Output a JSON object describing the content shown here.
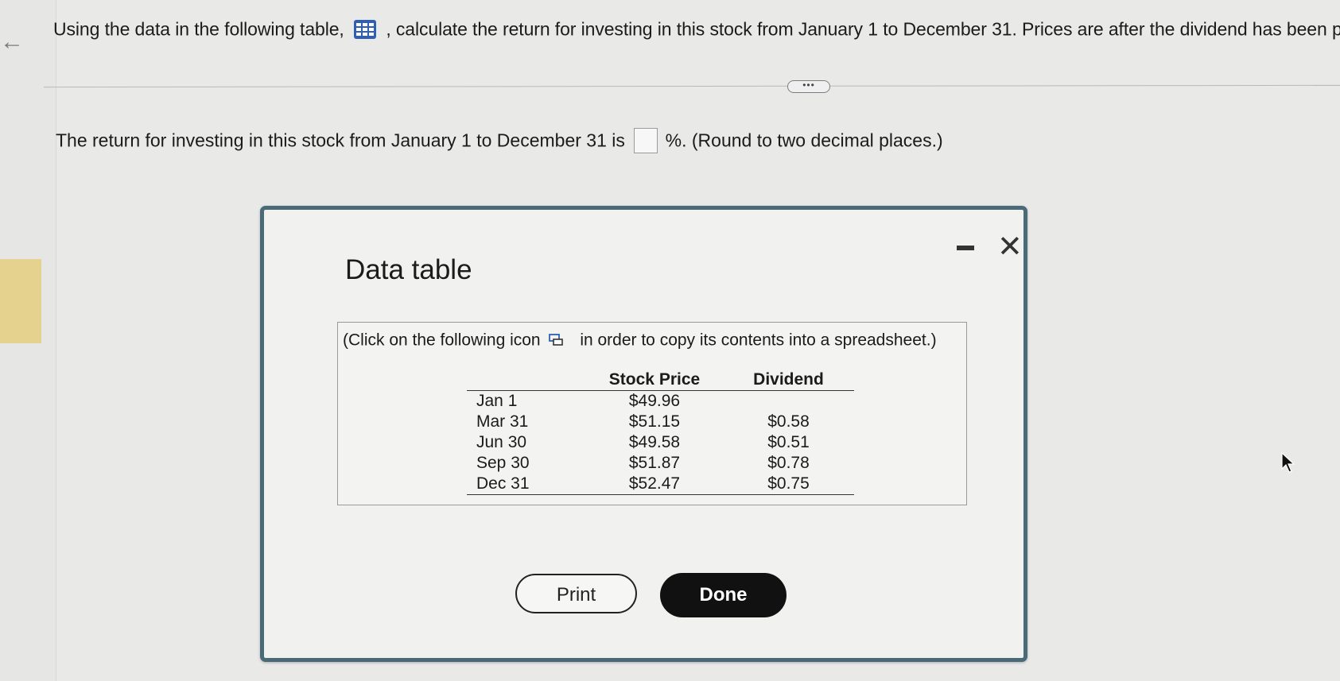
{
  "question": {
    "part1": "Using the data in the following table,",
    "part2": ", calculate the return for investing in this stock from January 1 to December 31. Prices are after the dividend has been paid."
  },
  "answer": {
    "prefix": "The return for investing in this stock from January 1 to December 31 is",
    "value": "",
    "suffix": "%. (Round to two decimal places.)"
  },
  "more_label": "•••",
  "modal": {
    "title": "Data table",
    "instruction_prefix": "(Click on the following icon",
    "instruction_suffix": "in order to copy its contents into a spreadsheet.)",
    "columns": [
      "",
      "Stock Price",
      "Dividend"
    ],
    "rows": [
      {
        "date": "Jan 1",
        "price": "$49.96",
        "dividend": ""
      },
      {
        "date": "Mar 31",
        "price": "$51.15",
        "dividend": "$0.58"
      },
      {
        "date": "Jun 30",
        "price": "$49.58",
        "dividend": "$0.51"
      },
      {
        "date": "Sep 30",
        "price": "$51.87",
        "dividend": "$0.78"
      },
      {
        "date": "Dec 31",
        "price": "$52.47",
        "dividend": "$0.75"
      }
    ],
    "print_label": "Print",
    "done_label": "Done",
    "close_label": "✕",
    "minimize_label": "–"
  },
  "icons": {
    "table": "table-grid-icon",
    "copy": "copy-spreadsheet-icon",
    "back": "back-arrow-icon",
    "cursor": "mouse-pointer-icon"
  },
  "colors": {
    "accent": "#2f5fb3",
    "modal_border": "#4a6a78",
    "done_bg": "#111111"
  }
}
